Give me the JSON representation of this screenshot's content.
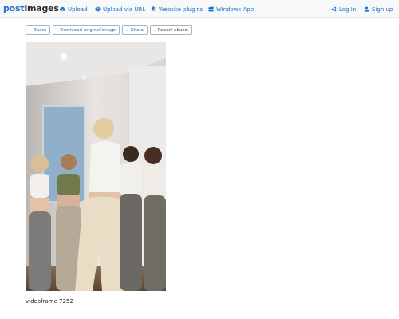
{
  "brand": {
    "part1": "post",
    "part2": "images"
  },
  "nav": {
    "upload": "Upload",
    "upload_url": "Upload via URL",
    "plugins": "Website plugins",
    "windows_app": "Windows App",
    "login": "Log In",
    "signup": "Sign up"
  },
  "actions": {
    "zoom": "Zoom",
    "download": "Download original image",
    "share": "Share",
    "report": "Report abuse"
  },
  "image": {
    "caption": "videoframe 7252"
  },
  "colors": {
    "link": "#1f6fc5",
    "brand_blue": "#1a73c8"
  }
}
